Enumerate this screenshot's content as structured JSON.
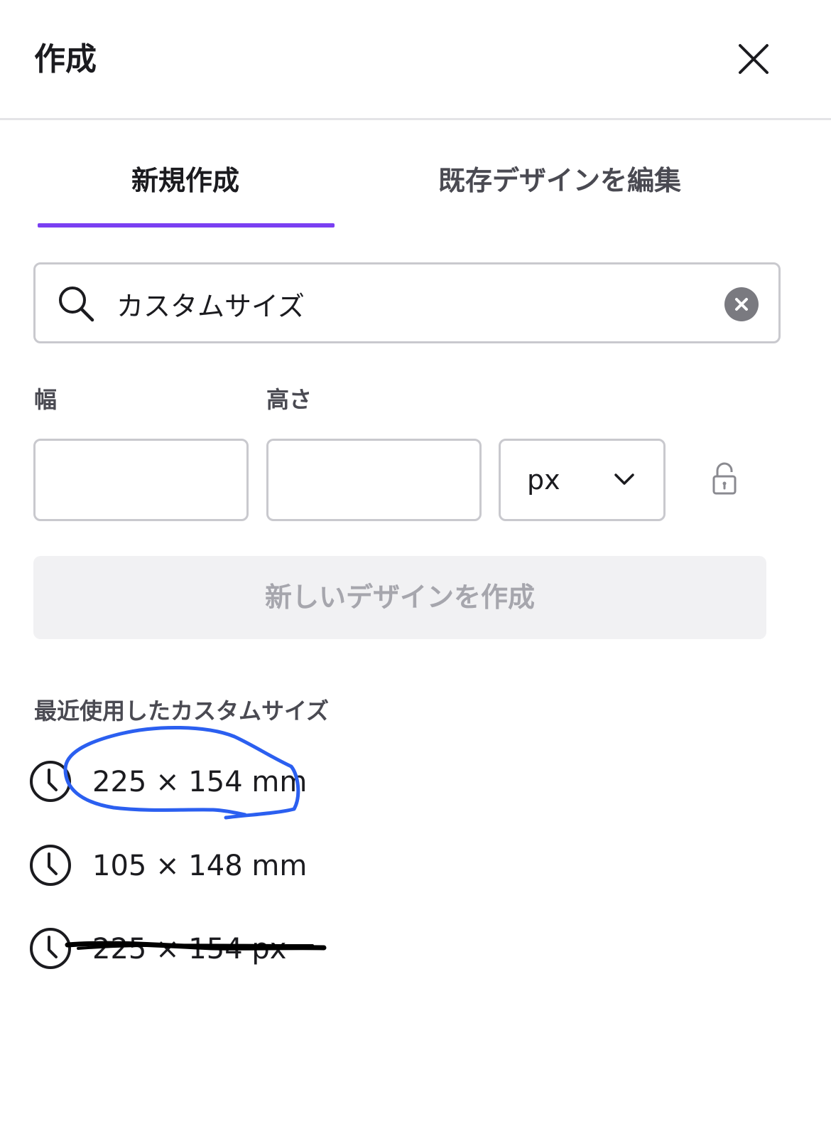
{
  "header": {
    "title": "作成",
    "close_icon": "close-icon"
  },
  "tabs": [
    {
      "label": "新規作成",
      "active": true
    },
    {
      "label": "既存デザインを編集",
      "active": false
    }
  ],
  "colors": {
    "accent": "#7a3ff2",
    "annotation_circle": "#2b5ff0",
    "annotation_strike": "#000000"
  },
  "search": {
    "value": "カスタムサイズ",
    "icon": "search-icon",
    "clear_icon": "clear-icon"
  },
  "size_form": {
    "width_label": "幅",
    "height_label": "高さ",
    "width_value": "",
    "height_value": "",
    "unit": "px",
    "lock_icon": "lock-icon"
  },
  "create_button": {
    "label": "新しいデザインを作成",
    "enabled": false
  },
  "recent": {
    "title": "最近使用したカスタムサイズ",
    "items": [
      {
        "label": "225 × 154 mm",
        "icon": "clock-icon",
        "annotation": "circled"
      },
      {
        "label": "105 × 148 mm",
        "icon": "clock-icon"
      },
      {
        "label": "225 × 154 px",
        "icon": "clock-icon",
        "annotation": "struck-through"
      }
    ]
  }
}
